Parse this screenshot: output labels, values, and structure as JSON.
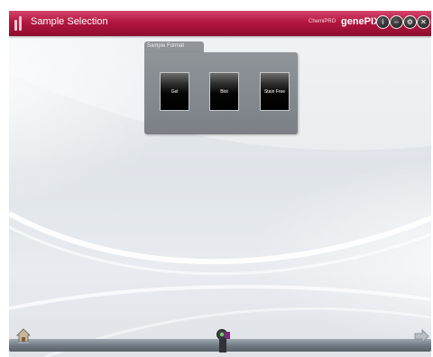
{
  "window": {
    "title": "Sample Selection",
    "brand_small": "ChemiPRO",
    "brand": "genePIX",
    "controls": [
      {
        "name": "info-button",
        "glyph": "i"
      },
      {
        "name": "minimize-button",
        "glyph": "–"
      },
      {
        "name": "settings-button",
        "glyph": "⚙"
      },
      {
        "name": "close-button",
        "glyph": "✕"
      }
    ],
    "accent_color": "#b3163f"
  },
  "panel": {
    "label": "Sample Format",
    "options": [
      "Gel",
      "Blot",
      "Stain Free"
    ]
  },
  "bottom": {
    "home_icon": "home-icon",
    "slider_icon": "slider-handle-icon",
    "next_icon": "next-arrow-icon"
  }
}
